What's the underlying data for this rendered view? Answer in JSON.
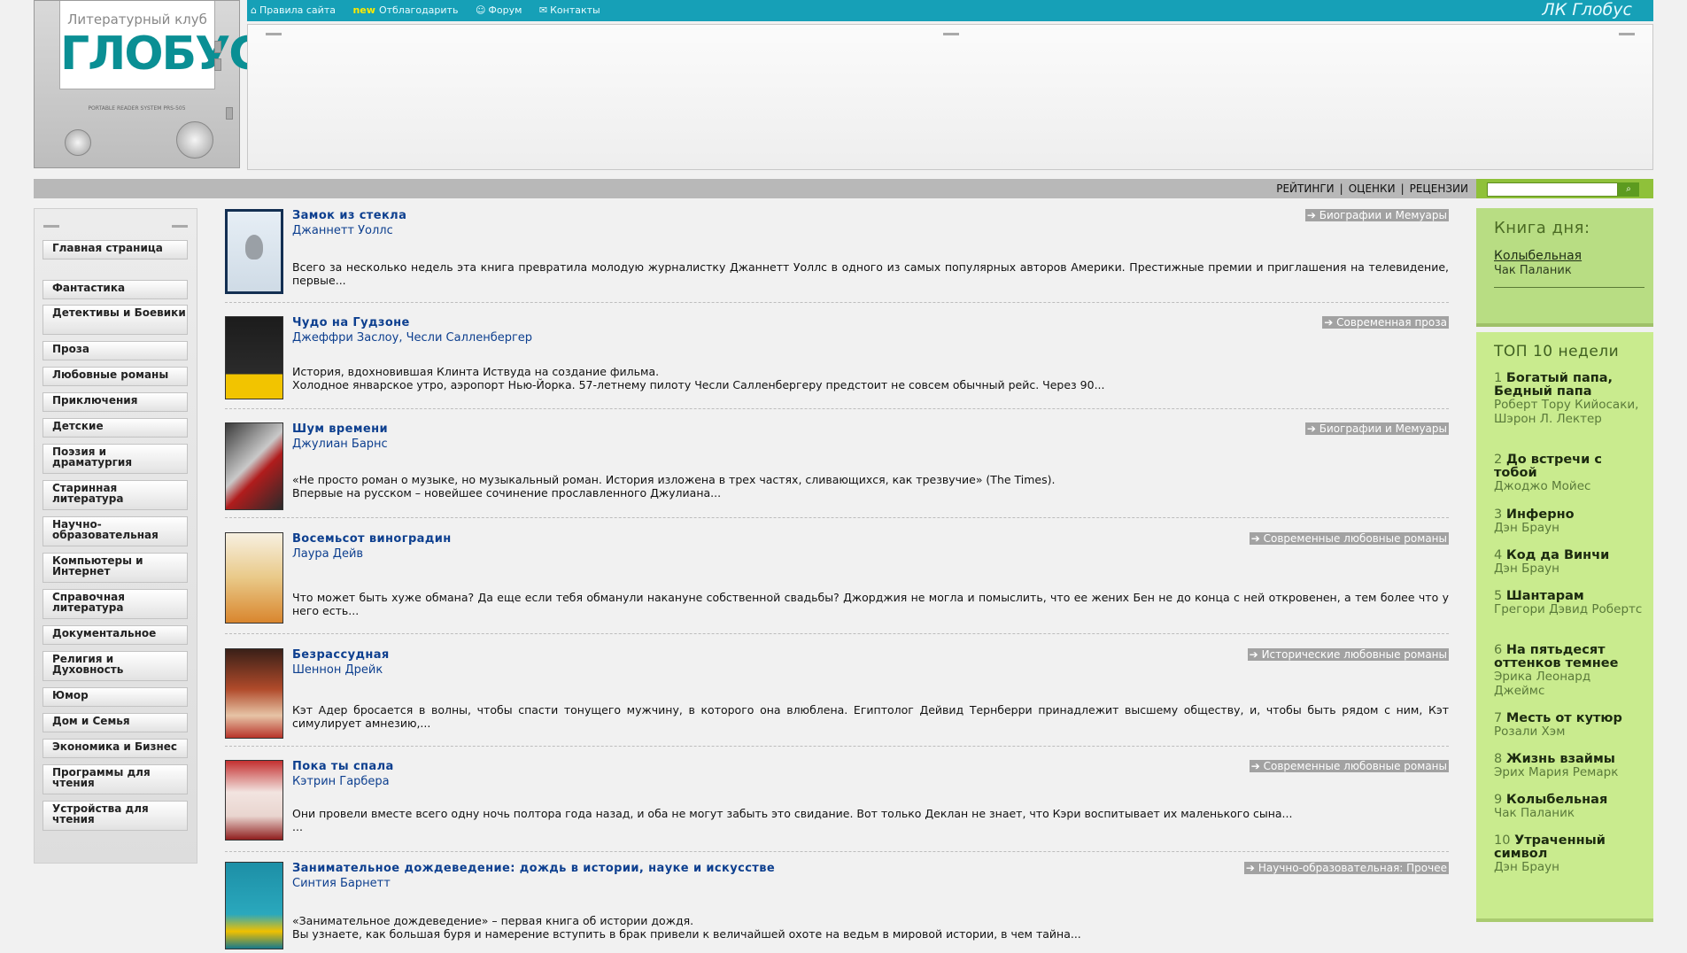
{
  "header": {
    "logo_club": "Литературный клуб",
    "logo_name": "ГЛОБУС",
    "logo_device": "PORTABLE READER SYSTEM PRS-505",
    "nav": [
      {
        "label": "Правила сайта",
        "icon": "home-icon"
      },
      {
        "label": "Отблагодарить",
        "badge": "new"
      },
      {
        "label": "Форум",
        "icon": "people-icon"
      },
      {
        "label": "Контакты",
        "icon": "mail-icon"
      }
    ],
    "brand": "ЛК Глобус"
  },
  "subnav": {
    "links": [
      "РЕЙТИНГИ",
      "ОЦЕНКИ",
      "РЕЦЕНЗИИ"
    ],
    "separator": "|",
    "search_placeholder": "",
    "search_icon": "search-icon"
  },
  "sidebar": {
    "items": [
      "Главная страница",
      "Фантастика",
      "Детективы и Боевики",
      "Проза",
      "Любовные романы",
      "Приключения",
      "Детские",
      "Поэзия и драматургия",
      "Старинная литература",
      "Научно-образовательная",
      "Компьютеры и Интернет",
      "Справочная литература",
      "Документальное",
      "Религия и Духовность",
      "Юмор",
      "Дом и Семья",
      "Экономика и Бизнес",
      "Программы для чтения",
      "Устройства для чтения"
    ]
  },
  "books": [
    {
      "title": "Замок из стекла",
      "author": "Джаннетт Уоллс",
      "genre": "Биографии и Мемуары",
      "desc": "Всего за несколько недель эта книга превратила молодую журналистку Джаннетт Уоллс в одного из самых популярных авторов Америки. Престижные премии и приглашения на телевидение, первые..."
    },
    {
      "title": "Чудо на Гудзоне",
      "author": "Джеффри Заслоу, Чесли Салленбергер",
      "genre": "Современная проза",
      "desc": "История, вдохновившая Клинта Иствуда на создание фильма.\nХолодное январское утро, аэропорт Нью-Йорка. 57-летнему пилоту Чесли Салленбергеру предстоит не совсем обычный рейс. Через 90..."
    },
    {
      "title": "Шум времени",
      "author": "Джулиан Барнс",
      "genre": "Биографии и Мемуары",
      "desc": "«Не просто роман о музыке, но музыкальный роман. История изложена в трех частях, сливающихся, как трезвучие» (The Times).\nВпервые на русском – новейшее сочинение прославленного Джулиана..."
    },
    {
      "title": "Восемьсот виноградин",
      "author": "Лаура Дейв",
      "genre": "Современные любовные романы",
      "desc": "Что может быть хуже обмана? Да еще если тебя обманули накануне собственной свадьбы? Джорджия не могла и помыслить, что ее жених Бен не до конца с ней откровенен, а тем более что у него есть..."
    },
    {
      "title": "Безрассудная",
      "author": "Шеннон Дрейк",
      "genre": "Исторические любовные романы",
      "desc": "Кэт Адер бросается в волны, чтобы спасти тонущего мужчину, в которого она влюблена. Египтолог Дейвид Тернберри принадлежит высшему обществу, и, чтобы быть рядом с ним, Кэт симулирует амнезию,..."
    },
    {
      "title": "Пока ты спала",
      "author": "Кэтрин Гарбера",
      "genre": "Современные любовные романы",
      "desc": "Они провели вместе всего одну ночь полтора года назад, и оба не могут забыть это свидание. Вот только Деклан не знает, что Кэри воспитывает их маленького сына...\n..."
    },
    {
      "title": "Занимательное дождеведение: дождь в истории, науке и искусстве",
      "author": "Синтия Барнетт",
      "genre": "Научно-образовательная: Прочее",
      "desc": "«Занимательное дождеведение» – первая книга об истории дождя.\nВы узнаете, как большая буря и намерение вступить в брак привели к величайшей охоте на ведьм в мировой истории, в чем тайна..."
    }
  ],
  "genre_arrow": "➔",
  "book_of_day": {
    "heading": "Книга дня:",
    "title": "Колыбельная",
    "author": "Чак Паланик"
  },
  "top10": {
    "heading": "ТОП 10 недели",
    "items": [
      {
        "n": "1",
        "title": "Богатый папа, Бедный папа",
        "author": "Роберт Тору Кийосаки, Шэрон Л. Лектер"
      },
      {
        "n": "2",
        "title": "До встречи с тобой",
        "author": "Джоджо Мойес"
      },
      {
        "n": "3",
        "title": "Инферно",
        "author": "Дэн Браун"
      },
      {
        "n": "4",
        "title": "Код да Винчи",
        "author": "Дэн Браун"
      },
      {
        "n": "5",
        "title": "Шантарам",
        "author": "Грегори Дэвид Робертс"
      },
      {
        "n": "6",
        "title": "На пятьдесят оттенков темнее",
        "author": "Эрика Леонард Джеймс"
      },
      {
        "n": "7",
        "title": "Месть от кутюр",
        "author": "Розали Хэм"
      },
      {
        "n": "8",
        "title": "Жизнь взаймы",
        "author": "Эрих Мария Ремарк"
      },
      {
        "n": "9",
        "title": "Колыбельная",
        "author": "Чак Паланик"
      },
      {
        "n": "10",
        "title": "Утраченный символ",
        "author": "Дэн Браун"
      }
    ]
  }
}
